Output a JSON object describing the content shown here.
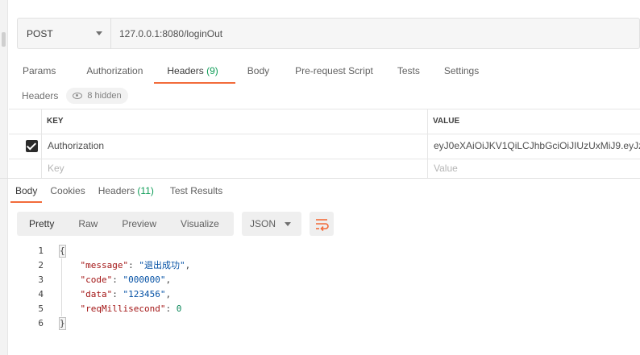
{
  "request": {
    "method": "POST",
    "url": "127.0.0.1:8080/loginOut"
  },
  "request_tabs": {
    "params": "Params",
    "authorization": "Authorization",
    "headers": "Headers",
    "headers_count": "(9)",
    "body": "Body",
    "pre_request_script": "Pre-request Script",
    "tests": "Tests",
    "settings": "Settings"
  },
  "headers_section": {
    "label": "Headers",
    "hidden": "8 hidden"
  },
  "headers_table": {
    "key_col": "KEY",
    "value_col": "VALUE",
    "rows": [
      {
        "key": "Authorization",
        "value": "eyJ0eXAiOiJKV1QiLCJhbGciOiJIUzUxMiJ9.eyJzdW",
        "checked": true
      }
    ],
    "key_placeholder": "Key",
    "value_placeholder": "Value"
  },
  "response_tabs": {
    "body": "Body",
    "cookies": "Cookies",
    "headers": "Headers",
    "headers_count": "(11)",
    "test_results": "Test Results"
  },
  "view": {
    "pretty": "Pretty",
    "raw": "Raw",
    "preview": "Preview",
    "visualize": "Visualize",
    "format": "JSON"
  },
  "response_body": {
    "line_numbers": [
      "1",
      "2",
      "3",
      "4",
      "5",
      "6"
    ],
    "open_brace": "{",
    "close_brace": "}",
    "fields": [
      {
        "key": "\"message\"",
        "value": "\"退出成功\"",
        "type": "string"
      },
      {
        "key": "\"code\"",
        "value": "\"000000\"",
        "type": "string"
      },
      {
        "key": "\"data\"",
        "value": "\"123456\"",
        "type": "string"
      },
      {
        "key": "\"reqMillisecond\"",
        "value": "0",
        "type": "number"
      }
    ]
  },
  "colors": {
    "accent": "#f26b3a",
    "count_green": "#0f9d58"
  },
  "icons": [
    "chevron-down-icon",
    "eye-icon",
    "checkbox-checked-icon",
    "wrap-lines-icon"
  ]
}
